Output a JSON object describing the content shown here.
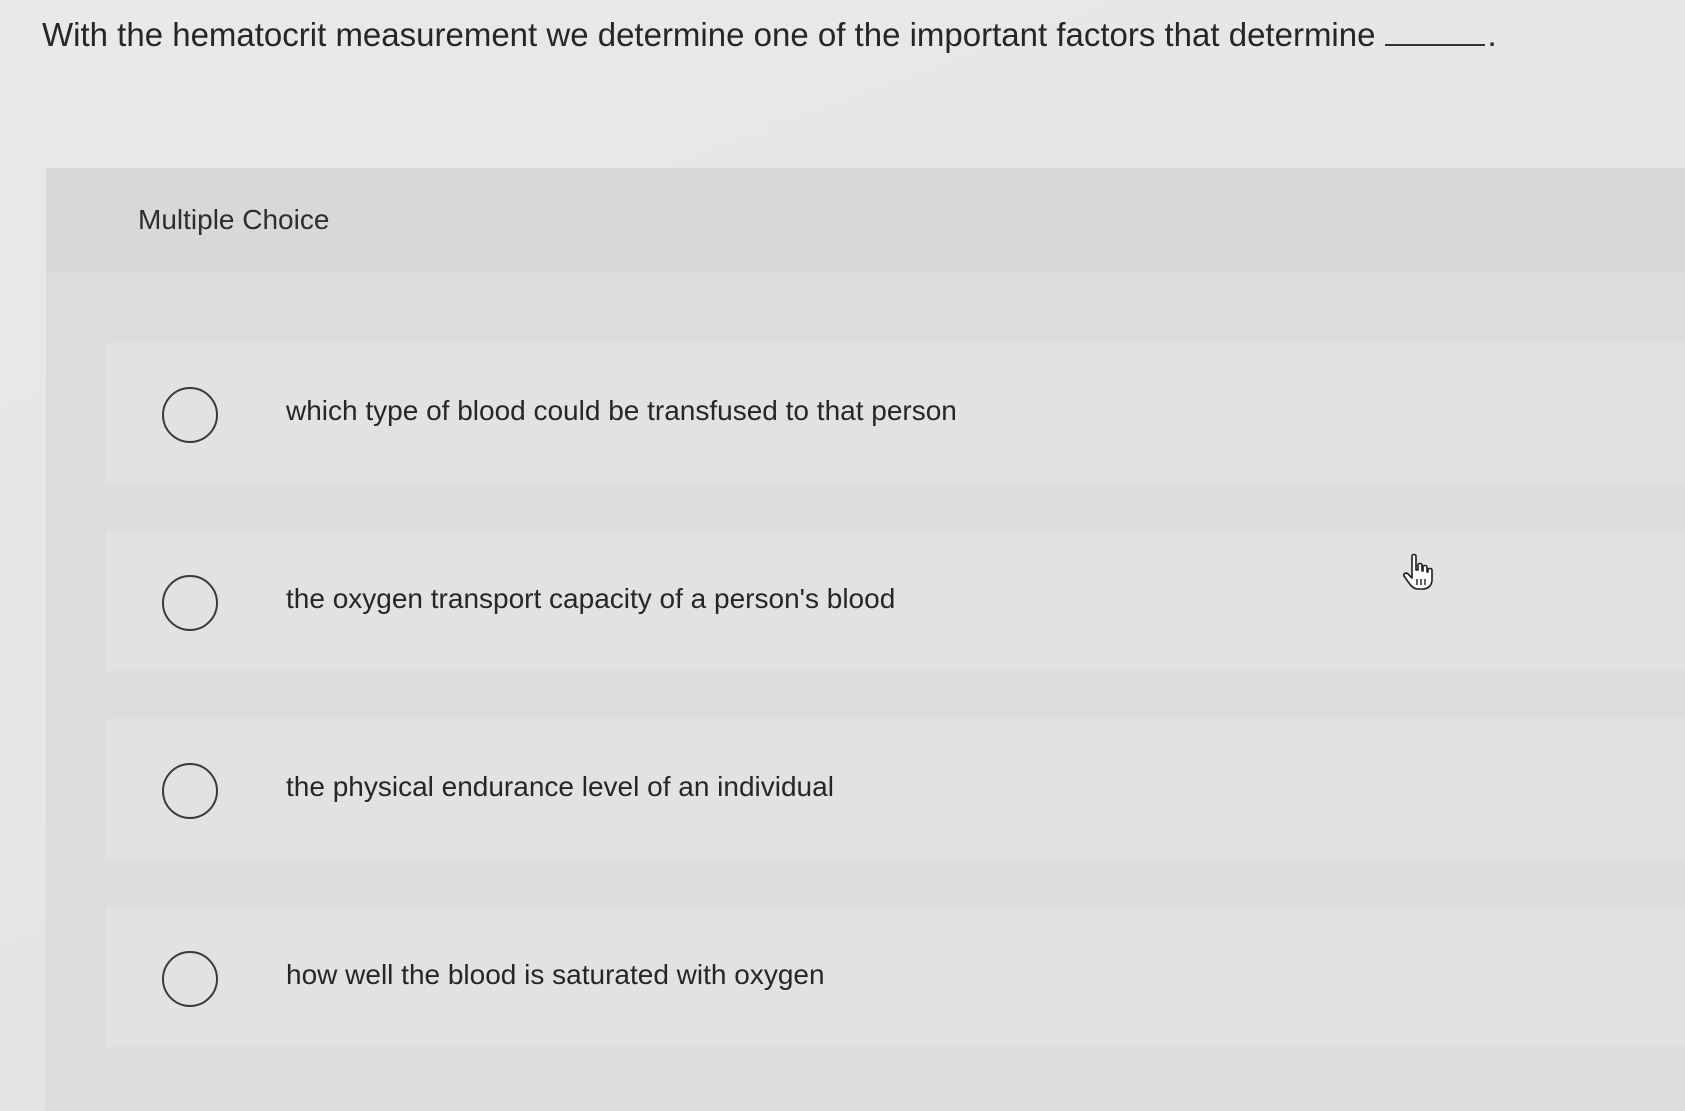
{
  "question": {
    "text": "With the hematocrit measurement we determine one of the important factors that determine",
    "end_punct": "."
  },
  "section": {
    "type_label": "Multiple Choice"
  },
  "options": [
    {
      "label": "which type of blood could be transfused to that person",
      "selected": false
    },
    {
      "label": "the oxygen transport capacity of a person's blood",
      "selected": false
    },
    {
      "label": "the physical endurance level of an individual",
      "selected": false
    },
    {
      "label": "how well the blood is saturated with oxygen",
      "selected": false
    }
  ],
  "icons": {
    "radio": "radio-circle-icon",
    "pointer": "hand-pointer-cursor-icon"
  },
  "colors": {
    "text": "#262626",
    "panel": "#dcdcda",
    "background": "#e6e6e4"
  }
}
